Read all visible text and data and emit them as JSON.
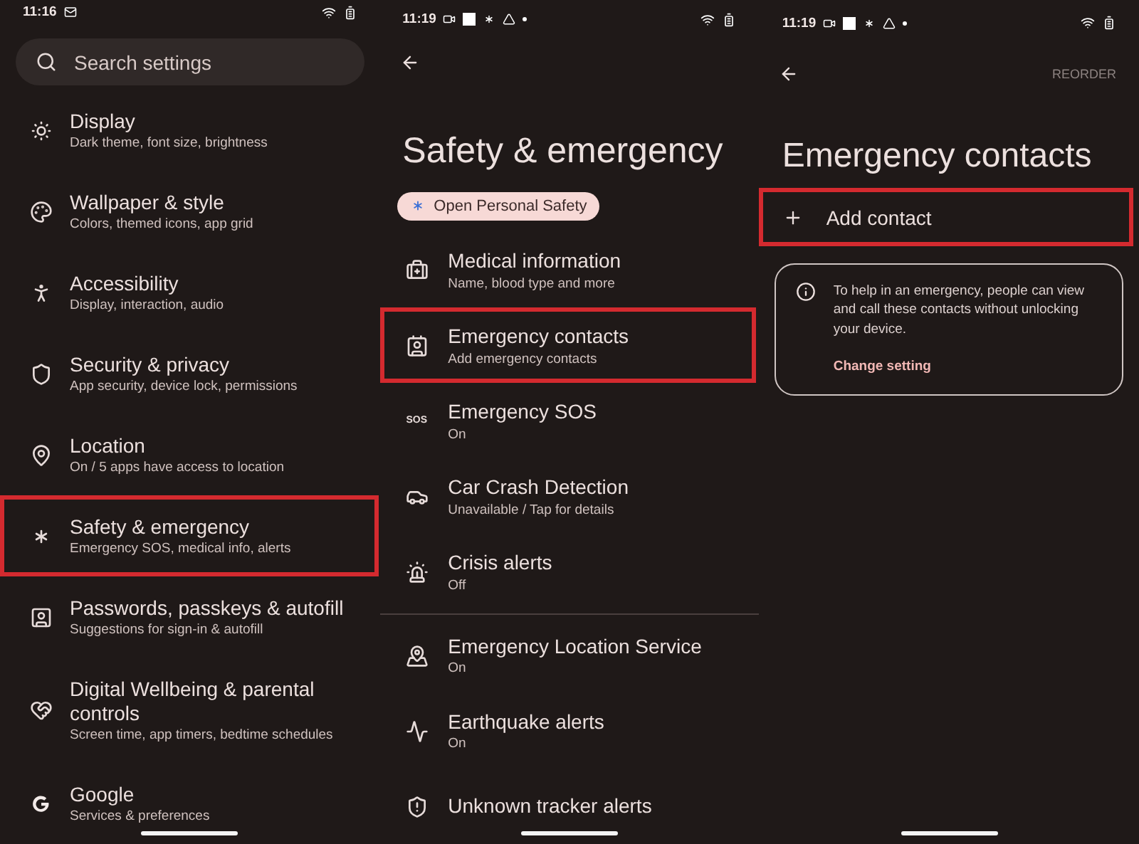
{
  "screens": [
    {
      "kind": "home",
      "status": {
        "time": "11:16"
      },
      "search": {
        "placeholder": "Search settings"
      },
      "items": [
        {
          "title": "Display",
          "subtitle": "Dark theme, font size, brightness",
          "highlighted": false
        },
        {
          "title": "Wallpaper & style",
          "subtitle": "Colors, themed icons, app grid",
          "highlighted": false
        },
        {
          "title": "Accessibility",
          "subtitle": "Display, interaction, audio",
          "highlighted": false
        },
        {
          "title": "Security & privacy",
          "subtitle": "App security, device lock, permissions",
          "highlighted": false
        },
        {
          "title": "Location",
          "subtitle": "On / 5 apps have access to location",
          "highlighted": false
        },
        {
          "title": "Safety & emergency",
          "subtitle": "Emergency SOS, medical info, alerts",
          "highlighted": true
        },
        {
          "title": "Passwords, passkeys & autofill",
          "subtitle": "Suggestions for sign-in & autofill",
          "highlighted": false
        },
        {
          "title": "Digital Wellbeing & parental controls",
          "subtitle": "Screen time, app timers, bedtime schedules",
          "highlighted": false
        },
        {
          "title": "Google",
          "subtitle": "Services & preferences",
          "highlighted": false
        }
      ]
    },
    {
      "kind": "list",
      "status": {
        "time": "11:19"
      },
      "title": "Safety & emergency",
      "chip": {
        "label": "Open Personal Safety"
      },
      "sections": [
        [
          {
            "title": "Medical information",
            "subtitle": "Name, blood type and more",
            "highlighted": false
          },
          {
            "title": "Emergency contacts",
            "subtitle": "Add emergency contacts",
            "highlighted": true
          },
          {
            "title": "Emergency SOS",
            "subtitle": "On",
            "icon_text": "SOS",
            "highlighted": false
          },
          {
            "title": "Car Crash Detection",
            "subtitle": "Unavailable / Tap for details",
            "highlighted": false
          },
          {
            "title": "Crisis alerts",
            "subtitle": "Off",
            "highlighted": false
          }
        ],
        [
          {
            "title": "Emergency Location Service",
            "subtitle": "On",
            "highlighted": false
          },
          {
            "title": "Earthquake alerts",
            "subtitle": "On",
            "highlighted": false
          },
          {
            "title": "Unknown tracker alerts",
            "highlighted": false
          }
        ]
      ]
    },
    {
      "kind": "detail",
      "status": {
        "time": "11:19"
      },
      "action": "REORDER",
      "title": "Emergency contacts",
      "add": {
        "label": "Add contact",
        "highlighted": true
      },
      "info": {
        "text": "To help in an emergency, people can view and call these contacts without unlocking your device.",
        "link": "Change setting"
      }
    }
  ]
}
